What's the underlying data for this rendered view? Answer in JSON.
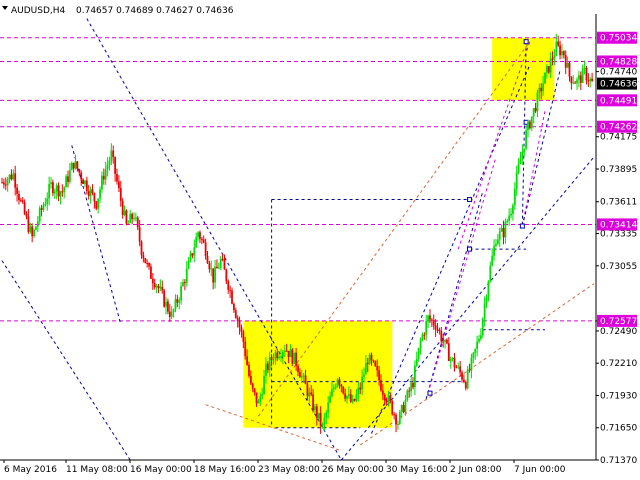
{
  "header": {
    "symbol": "AUDUSD,H4",
    "ohlc": "0.74657 0.74689 0.74627 0.74636"
  },
  "colors": {
    "bull": "#00dd00",
    "bear": "#ee0000",
    "level": "#dd00dd",
    "trend": "#0000aa",
    "channel": "#dd6633",
    "zone": "#ffff00",
    "current_tag": "#000000"
  },
  "chart_data": {
    "type": "candlestick",
    "title": "",
    "xlabel": "",
    "ylabel": "",
    "ylim": [
      0.7137,
      0.7524
    ],
    "x_ticks": [
      "6 May 2016",
      "11 May 08:00",
      "16 May 00:00",
      "18 May 16:00",
      "23 May 08:00",
      "26 May 00:00",
      "30 May 16:00",
      "2 Jun 08:00",
      "7 Jun 00:00"
    ],
    "y_ticks": [
      "0.74740",
      "0.74175",
      "0.73895",
      "0.73611",
      "0.73335",
      "0.73055",
      "0.72577",
      "0.72490",
      "0.72210",
      "0.71930",
      "0.71650",
      "0.71370"
    ],
    "y_tick_values": [
      0.7474,
      0.74175,
      0.73895,
      0.73611,
      0.73335,
      0.73055,
      0.72577,
      0.7249,
      0.7221,
      0.7193,
      0.7165,
      0.7137
    ],
    "levels": [
      {
        "label": "0.75034",
        "value": 0.75034
      },
      {
        "label": "0.74828",
        "value": 0.74828
      },
      {
        "label": "0.74491",
        "value": 0.74491
      },
      {
        "label": "0.74262",
        "value": 0.74262
      },
      {
        "label": "0.73414",
        "value": 0.73414
      },
      {
        "label": "0.72577",
        "value": 0.72577
      }
    ],
    "current_price": {
      "label": "0.74636",
      "value": 0.74636
    },
    "close_path": [
      [
        0,
        0.7378
      ],
      [
        6,
        0.7385
      ],
      [
        10,
        0.736
      ],
      [
        16,
        0.733
      ],
      [
        20,
        0.735
      ],
      [
        26,
        0.7375
      ],
      [
        32,
        0.737
      ],
      [
        38,
        0.7395
      ],
      [
        44,
        0.7378
      ],
      [
        50,
        0.736
      ],
      [
        54,
        0.7385
      ],
      [
        58,
        0.7402
      ],
      [
        62,
        0.737
      ],
      [
        66,
        0.734
      ],
      [
        70,
        0.735
      ],
      [
        74,
        0.732
      ],
      [
        78,
        0.73
      ],
      [
        82,
        0.729
      ],
      [
        86,
        0.7275
      ],
      [
        90,
        0.7262
      ],
      [
        94,
        0.728
      ],
      [
        98,
        0.73
      ],
      [
        104,
        0.7335
      ],
      [
        108,
        0.732
      ],
      [
        112,
        0.7295
      ],
      [
        116,
        0.731
      ],
      [
        120,
        0.729
      ],
      [
        124,
        0.7265
      ],
      [
        128,
        0.724
      ],
      [
        132,
        0.72
      ],
      [
        136,
        0.7185
      ],
      [
        140,
        0.7215
      ],
      [
        144,
        0.7228
      ],
      [
        150,
        0.7235
      ],
      [
        156,
        0.7222
      ],
      [
        160,
        0.7205
      ],
      [
        166,
        0.718
      ],
      [
        170,
        0.7165
      ],
      [
        174,
        0.719
      ],
      [
        178,
        0.721
      ],
      [
        182,
        0.7195
      ],
      [
        186,
        0.7185
      ],
      [
        190,
        0.72
      ],
      [
        194,
        0.7225
      ],
      [
        198,
        0.7215
      ],
      [
        202,
        0.7198
      ],
      [
        206,
        0.7185
      ],
      [
        210,
        0.717
      ],
      [
        214,
        0.7188
      ],
      [
        218,
        0.7205
      ],
      [
        222,
        0.724
      ],
      [
        226,
        0.726
      ],
      [
        230,
        0.7255
      ],
      [
        234,
        0.724
      ],
      [
        238,
        0.7225
      ],
      [
        242,
        0.7215
      ],
      [
        246,
        0.7205
      ],
      [
        250,
        0.7225
      ],
      [
        254,
        0.725
      ],
      [
        258,
        0.7295
      ],
      [
        262,
        0.733
      ],
      [
        266,
        0.7335
      ],
      [
        270,
        0.7355
      ],
      [
        274,
        0.739
      ],
      [
        278,
        0.742
      ],
      [
        282,
        0.744
      ],
      [
        286,
        0.746
      ],
      [
        290,
        0.7478
      ],
      [
        294,
        0.7495
      ],
      [
        298,
        0.749
      ],
      [
        301,
        0.747
      ],
      [
        305,
        0.7465
      ],
      [
        309,
        0.7473
      ],
      [
        313,
        0.7464
      ]
    ],
    "candle_count": 314
  }
}
